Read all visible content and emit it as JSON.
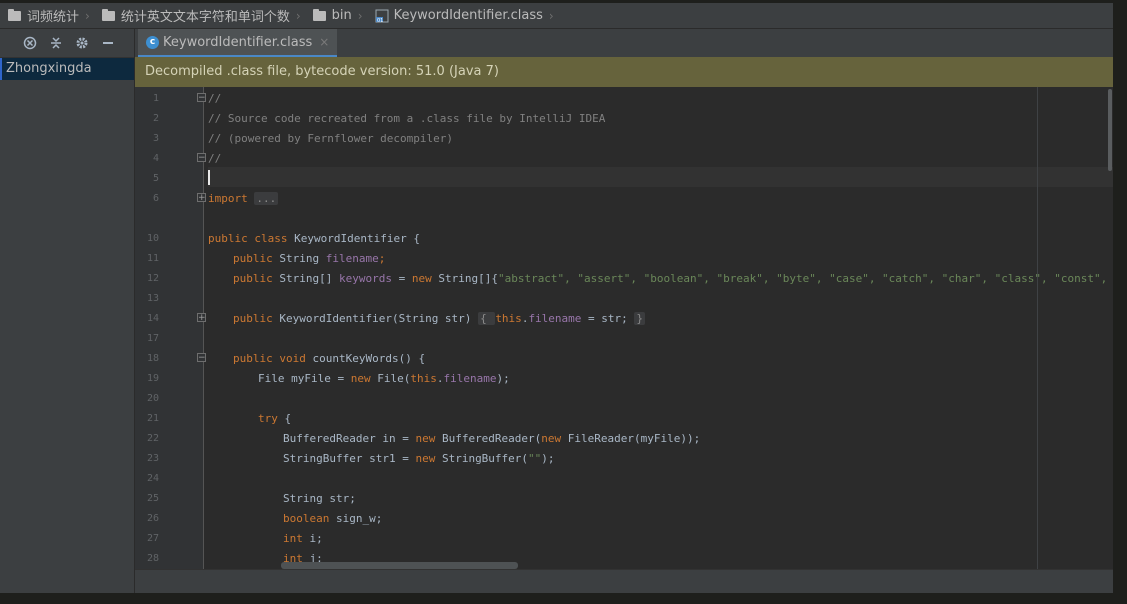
{
  "breadcrumb": [
    {
      "label": "词频统计",
      "icon": "folder-icon"
    },
    {
      "label": "统计英文文本字符和单词个数",
      "icon": "folder-icon"
    },
    {
      "label": "bin",
      "icon": "folder-icon"
    },
    {
      "label": "KeywordIdentifier.class",
      "icon": "class-file-icon"
    }
  ],
  "left_panel": {
    "toolbar": [
      "locate-icon",
      "collapse-icon",
      "gear-icon",
      "hide-icon"
    ],
    "project_label": "Zhongxingda"
  },
  "tab": {
    "label": "KeywordIdentifier.class",
    "icon_letter": "c",
    "close": "×"
  },
  "banner": "Decompiled .class file, bytecode version: 51.0 (Java 7)",
  "line_numbers": [
    "1",
    "2",
    "3",
    "4",
    "5",
    "6",
    "10",
    "11",
    "12",
    "13",
    "14",
    "17",
    "18",
    "19",
    "20",
    "21",
    "22",
    "23",
    "24",
    "25",
    "26",
    "27",
    "28"
  ],
  "code": {
    "l1": "//",
    "l2": "// Source code recreated from a .class file by IntelliJ IDEA",
    "l3": "// (powered by Fernflower decompiler)",
    "l4": "//",
    "l6_kw": "import",
    "l6_fold": "...",
    "l10_kw": "public class",
    "l10_rest": " KeywordIdentifier {",
    "l11_kw": "public",
    "l11_type": " String ",
    "l11_field": "filename",
    "l11_end": ";",
    "l12_kw": "public",
    "l12_type": " String[] ",
    "l12_field": "keywords",
    "l12_eq": " = ",
    "l12_new": "new",
    "l12_arr": " String[]{",
    "l12_strings": "\"abstract\", \"assert\", \"boolean\", \"break\", \"byte\", \"case\", \"catch\", \"char\", \"class\", \"const\", \"contin",
    "l14_kw": "public",
    "l14_sig": " KeywordIdentifier(String str) ",
    "l14_open": "{ ",
    "l14_this": "this",
    "l14_dot": ".",
    "l14_field": "filename",
    "l14_assign": " = str; ",
    "l14_close": "}",
    "l18_kw": "public void",
    "l18_rest": " countKeyWords() {",
    "l19_a": "File myFile = ",
    "l19_new": "new",
    "l19_b": " File(",
    "l19_this": "this",
    "l19_dot": ".",
    "l19_field": "filename",
    "l19_end": ");",
    "l21_kw": "try",
    "l21_rest": " {",
    "l22_a": "BufferedReader in = ",
    "l22_new1": "new",
    "l22_b": " BufferedReader(",
    "l22_new2": "new",
    "l22_c": " FileReader(myFile));",
    "l23_a": "StringBuffer str1 = ",
    "l23_new": "new",
    "l23_b": " StringBuffer(",
    "l23_str": "\"\"",
    "l23_end": ");",
    "l25": "String str;",
    "l26_kw": "boolean",
    "l26_rest": " sign_w;",
    "l27_kw": "int",
    "l27_rest": " i;",
    "l28_kw": "int",
    "l28_rest": " j;"
  },
  "colors": {
    "keyword": "#cc7832",
    "comment": "#808080",
    "string": "#6a8759",
    "field": "#9876aa",
    "banner_bg": "#66633c"
  }
}
